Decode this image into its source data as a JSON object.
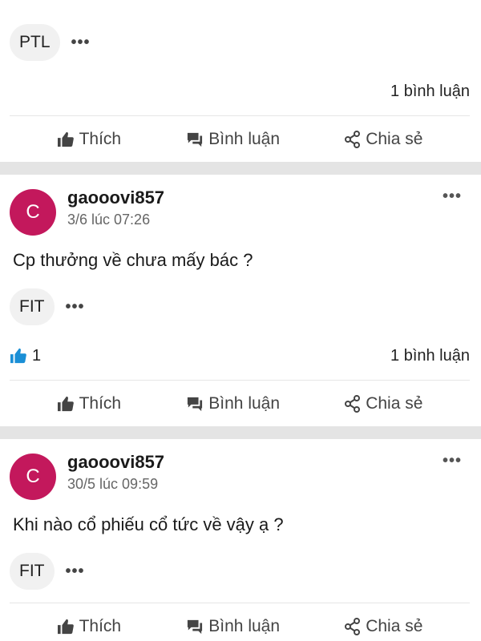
{
  "top_post": {
    "tag": "PTL",
    "more": "•••",
    "comment_count": "1 bình luận"
  },
  "actions": {
    "like": "Thích",
    "comment": "Bình luận",
    "share": "Chia sẻ"
  },
  "posts": [
    {
      "avatar_letter": "C",
      "author": "gaooovi857",
      "time": "3/6 lúc 07:26",
      "menu": "•••",
      "body": "Cp thưởng về chưa mấy bác ?",
      "tag": "FIT",
      "more": "•••",
      "likes": "1",
      "comment_count": "1 bình luận"
    },
    {
      "avatar_letter": "C",
      "author": "gaooovi857",
      "time": "30/5 lúc 09:59",
      "menu": "•••",
      "body": "Khi nào cổ phiếu cổ tức về vậy ạ ?",
      "tag": "FIT",
      "more": "•••"
    }
  ],
  "colors": {
    "avatar": "#c3185c",
    "like_active": "#1a8fd6",
    "divider": "#e4e4e4"
  }
}
